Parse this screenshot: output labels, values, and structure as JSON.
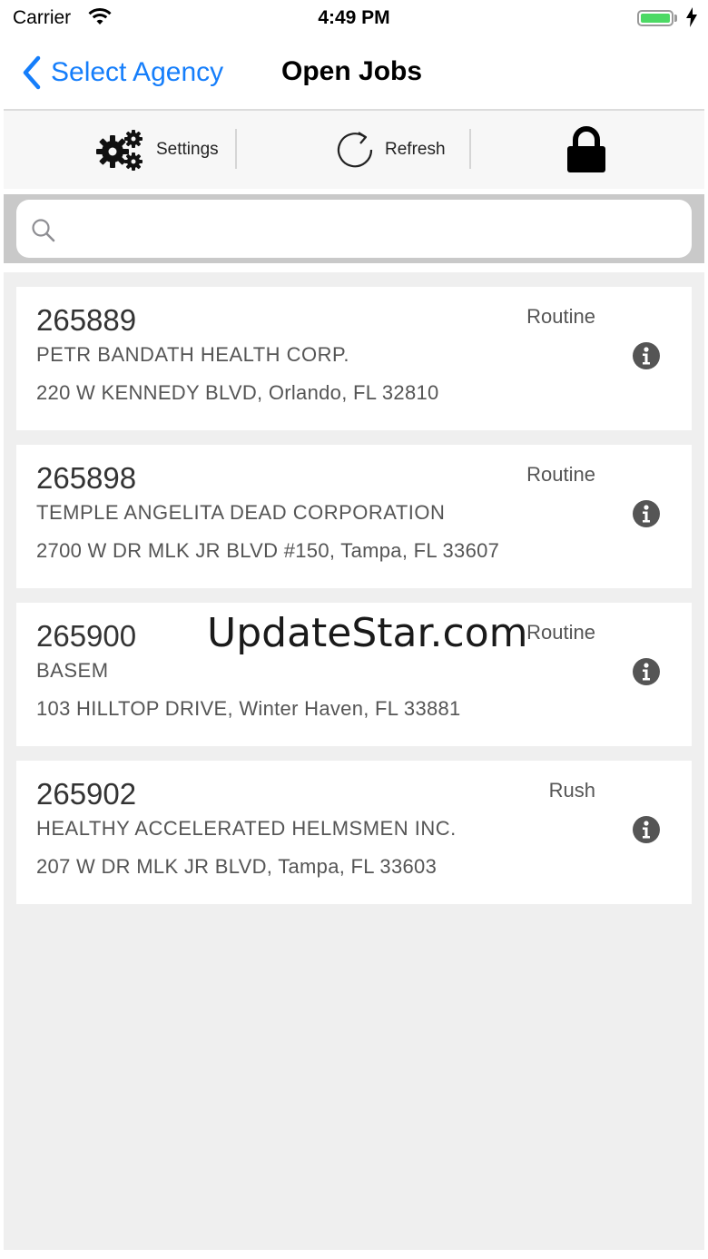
{
  "status_bar": {
    "carrier": "Carrier",
    "time": "4:49 PM",
    "wifi_icon": "wifi-icon",
    "battery_icon": "battery-icon",
    "battery_level": 1.0,
    "charging_icon": "bolt-icon"
  },
  "nav": {
    "back_label": "Select Agency",
    "title": "Open Jobs",
    "accent_color": "#157efb"
  },
  "toolbar": {
    "settings_label": "Settings",
    "refresh_label": "Refresh",
    "lock_icon": "lock-icon"
  },
  "search": {
    "placeholder": "",
    "value": ""
  },
  "jobs": [
    {
      "id": "265889",
      "priority": "Routine",
      "company": "PETR BANDATH HEALTH CORP.",
      "address": "220 W KENNEDY BLVD, Orlando, FL  32810"
    },
    {
      "id": "265898",
      "priority": "Routine",
      "company": "TEMPLE ANGELITA DEAD CORPORATION",
      "address": "2700 W DR MLK JR BLVD #150, Tampa, FL  33607"
    },
    {
      "id": "265900",
      "priority": "Routine",
      "company": "BASEM",
      "address": "103 HILLTOP DRIVE, Winter Haven, FL  33881"
    },
    {
      "id": "265902",
      "priority": "Rush",
      "company": "HEALTHY ACCELERATED HELMSMEN INC.",
      "address": "207 W DR MLK JR BLVD, Tampa, FL  33603"
    }
  ],
  "watermark": "UpdateStar.com"
}
